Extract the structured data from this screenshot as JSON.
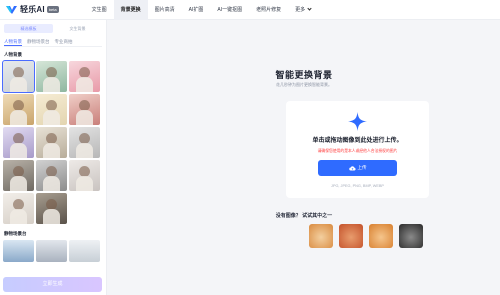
{
  "brand": {
    "name": "轻乐AI",
    "badge": "beta",
    "colors": {
      "primary": "#2f6bff",
      "warning": "#ff3b3b",
      "accent": "#4a6cff"
    }
  },
  "nav": {
    "items": [
      {
        "label": "文生图",
        "active": false
      },
      {
        "label": "背景更换",
        "active": true
      },
      {
        "label": "图片高清",
        "active": false
      },
      {
        "label": "AI扩图",
        "active": false
      },
      {
        "label": "AI一键抠图",
        "active": false
      },
      {
        "label": "老照片修复",
        "active": false
      }
    ],
    "more_label": "更多"
  },
  "left": {
    "mode_tabs": [
      "精选模板",
      "文生背景"
    ],
    "sub_tabs": [
      "人物背景",
      "静物场景台",
      "专业商拍"
    ],
    "section1_title": "人物背景",
    "section2_title": "静物场景台",
    "generate_label": "立即生成",
    "thumbnails": [
      {
        "c1": "#c9cfd3",
        "c2": "#e7eaec"
      },
      {
        "c1": "#8fb7a0",
        "c2": "#d6e6d8"
      },
      {
        "c1": "#e89aa8",
        "c2": "#f7d7dd"
      },
      {
        "c1": "#c9a46b",
        "c2": "#efdcb8"
      },
      {
        "c1": "#e3d5b0",
        "c2": "#f6ecd4"
      },
      {
        "c1": "#c97f7a",
        "c2": "#f0cfc8"
      },
      {
        "c1": "#a79ac9",
        "c2": "#e2dcf2"
      },
      {
        "c1": "#b8ad9a",
        "c2": "#e8e2d6"
      },
      {
        "c1": "#b7b7b7",
        "c2": "#e3e3e3"
      },
      {
        "c1": "#6f6a63",
        "c2": "#b9b2a8"
      },
      {
        "c1": "#8d8d8d",
        "c2": "#d1d1d1"
      },
      {
        "c1": "#c9c3c0",
        "c2": "#eeeae7"
      },
      {
        "c1": "#d6cfc7",
        "c2": "#f2eee9"
      },
      {
        "c1": "#5a524a",
        "c2": "#a89e90"
      }
    ],
    "scene_thumbnails": [
      {
        "c1": "#8aa9c9",
        "c2": "#d9e6f2"
      },
      {
        "c1": "#a9b2bf",
        "c2": "#e2e6ec"
      },
      {
        "c1": "#c7cfd6",
        "c2": "#eef1f4"
      }
    ]
  },
  "main": {
    "title": "智能更换背景",
    "subtitle": "花几秒钟为图片更换智能背景。",
    "card": {
      "headline": "单击或拖动图像到此处进行上传。",
      "warning": "请确保您使用的是本人或经他人合法授权的图片",
      "upload_label": "上传",
      "formats": "JPG, JPEG, PNG, BMP, WEBP"
    },
    "try_label": "没有图像？ 试试其中之一",
    "samples": [
      {
        "name": "sample-bottle",
        "c1": "#d98a3f",
        "c2": "#f3cf9f"
      },
      {
        "name": "sample-food",
        "c1": "#c4512a",
        "c2": "#e89c6d"
      },
      {
        "name": "sample-dog",
        "c1": "#d87f2e",
        "c2": "#f5c58c"
      },
      {
        "name": "sample-woman",
        "c1": "#2a2a2a",
        "c2": "#8a8a8a"
      }
    ]
  }
}
